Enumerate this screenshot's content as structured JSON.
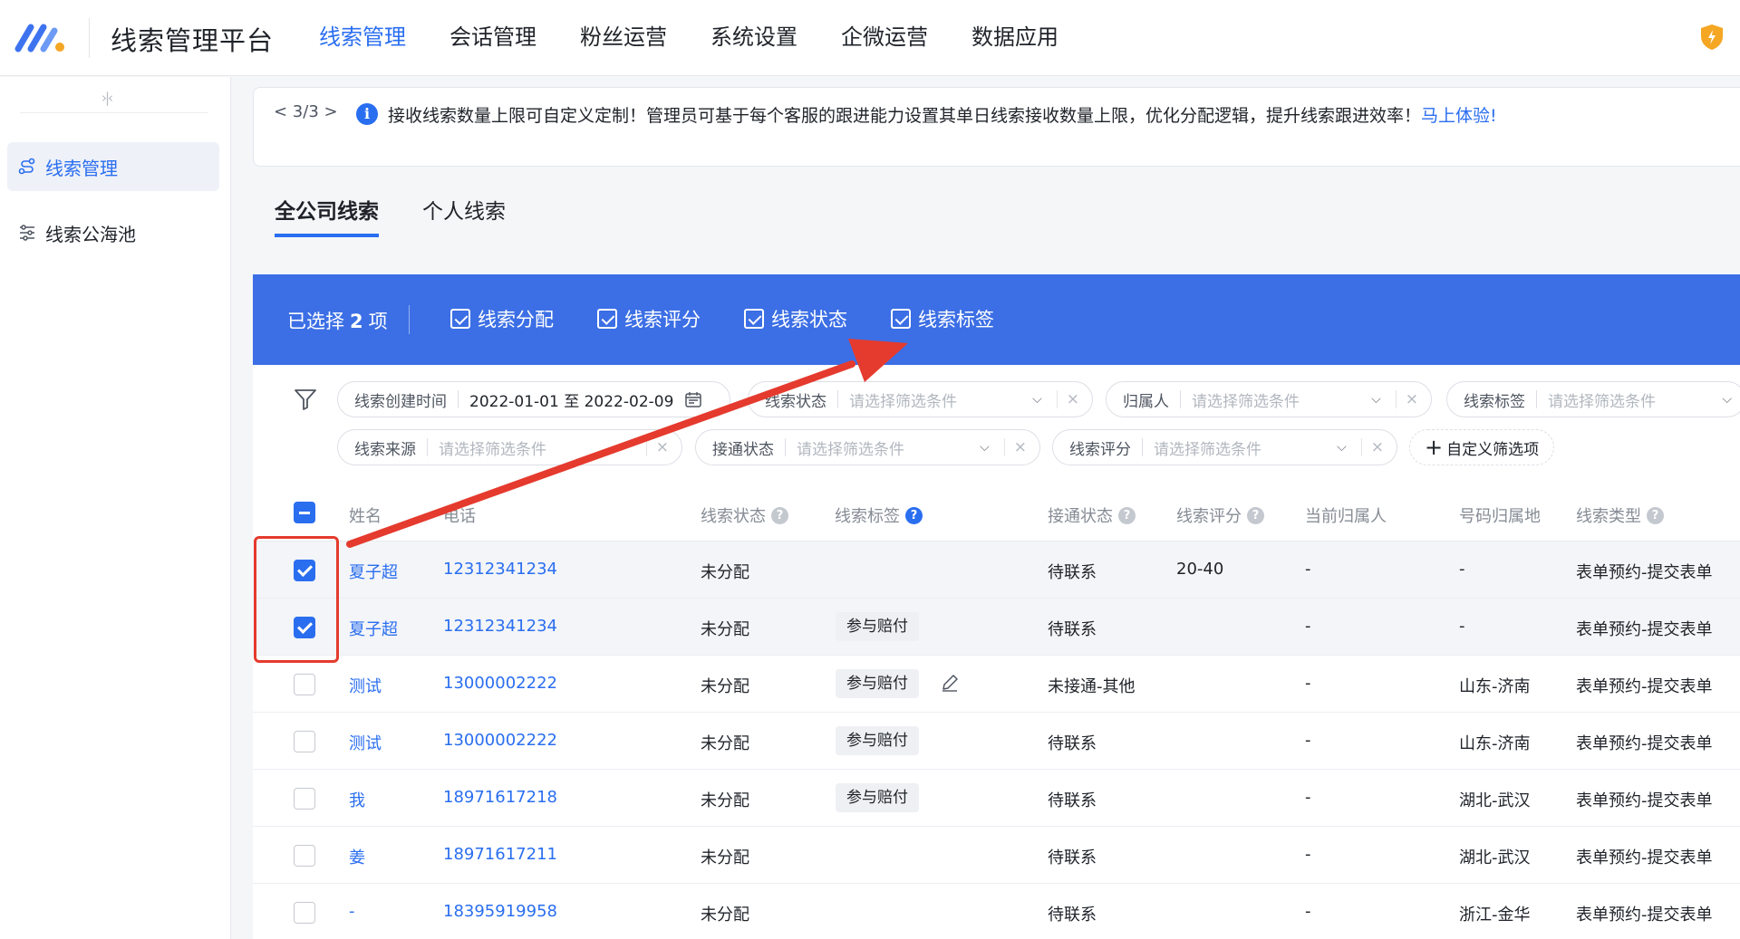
{
  "header": {
    "app_title": "线索管理平台",
    "nav": [
      {
        "label": "线索管理",
        "active": true
      },
      {
        "label": "会话管理"
      },
      {
        "label": "粉丝运营"
      },
      {
        "label": "系统设置"
      },
      {
        "label": "企微运营"
      },
      {
        "label": "数据应用"
      }
    ]
  },
  "sidebar": {
    "collapse_glyph": "›|‹",
    "items": [
      {
        "label": "线索管理",
        "icon": "flow-icon",
        "active": true
      },
      {
        "label": "线索公海池",
        "icon": "filter-list-icon"
      }
    ]
  },
  "notice": {
    "pager": "< 3/3 >",
    "icon_glyph": "i",
    "text": "接收线索数量上限可自定义定制！管理员可基于每个客服的跟进能力设置其单日线索接收数量上限，优化分配逻辑，提升线索跟进效率！",
    "link": "马上体验!"
  },
  "tabs": [
    {
      "label": "全公司线索",
      "active": true
    },
    {
      "label": "个人线索"
    }
  ],
  "batch": {
    "selected_prefix": "已选择",
    "selected_count": "2",
    "selected_suffix": "项",
    "actions": [
      "线索分配",
      "线索评分",
      "线索状态",
      "线索标签"
    ]
  },
  "filters": {
    "row1": [
      {
        "key": "线索创建时间",
        "value": "2022-01-01 至 2022-02-09"
      },
      {
        "key": "线索状态",
        "placeholder": "请选择筛选条件"
      },
      {
        "key": "归属人",
        "placeholder": "请选择筛选条件"
      },
      {
        "key": "线索标签",
        "placeholder": "请选择筛选条件"
      }
    ],
    "row2": [
      {
        "key": "线索来源",
        "placeholder": "请选择筛选条件"
      },
      {
        "key": "接通状态",
        "placeholder": "请选择筛选条件"
      },
      {
        "key": "线索评分",
        "placeholder": "请选择筛选条件"
      }
    ],
    "add_label": "自定义筛选项",
    "clear_glyph": "×",
    "dropdown_glyph": "⌵"
  },
  "table": {
    "columns": [
      "姓名",
      "电话",
      "线索状态",
      "线索标签",
      "接通状态",
      "线索评分",
      "当前归属人",
      "号码归属地",
      "线索类型"
    ],
    "q_glyph": "?",
    "rows": [
      {
        "name": "夏子超",
        "phone": "12312341234",
        "status": "未分配",
        "tag": "",
        "connect": "待联系",
        "score": "20-40",
        "owner": "-",
        "location": "-",
        "type": "表单预约-提交表单",
        "checked": true
      },
      {
        "name": "夏子超",
        "phone": "12312341234",
        "status": "未分配",
        "tag": "参与赔付",
        "connect": "待联系",
        "score": "",
        "owner": "-",
        "location": "-",
        "type": "表单预约-提交表单",
        "checked": true
      },
      {
        "name": "测试",
        "phone": "13000002222",
        "status": "未分配",
        "tag": "参与赔付",
        "connect": "未接通-其他",
        "score": "",
        "owner": "-",
        "location": "山东-济南",
        "type": "表单预约-提交表单",
        "checked": false,
        "edit": true
      },
      {
        "name": "测试",
        "phone": "13000002222",
        "status": "未分配",
        "tag": "参与赔付",
        "connect": "待联系",
        "score": "",
        "owner": "-",
        "location": "山东-济南",
        "type": "表单预约-提交表单",
        "checked": false
      },
      {
        "name": "我",
        "phone": "18971617218",
        "status": "未分配",
        "tag": "参与赔付",
        "connect": "待联系",
        "score": "",
        "owner": "-",
        "location": "湖北-武汉",
        "type": "表单预约-提交表单",
        "checked": false
      },
      {
        "name": "姜",
        "phone": "18971617211",
        "status": "未分配",
        "tag": "",
        "connect": "待联系",
        "score": "",
        "owner": "-",
        "location": "湖北-武汉",
        "type": "表单预约-提交表单",
        "checked": false
      },
      {
        "name": "-",
        "phone": "18395919958",
        "status": "未分配",
        "tag": "",
        "connect": "待联系",
        "score": "",
        "owner": "-",
        "location": "浙江-金华",
        "type": "表单预约-提交表单",
        "checked": false
      }
    ]
  },
  "colors": {
    "accent": "#2a6ef0",
    "batch_bar": "#3c6fe5",
    "annotation": "#e53a2e"
  }
}
